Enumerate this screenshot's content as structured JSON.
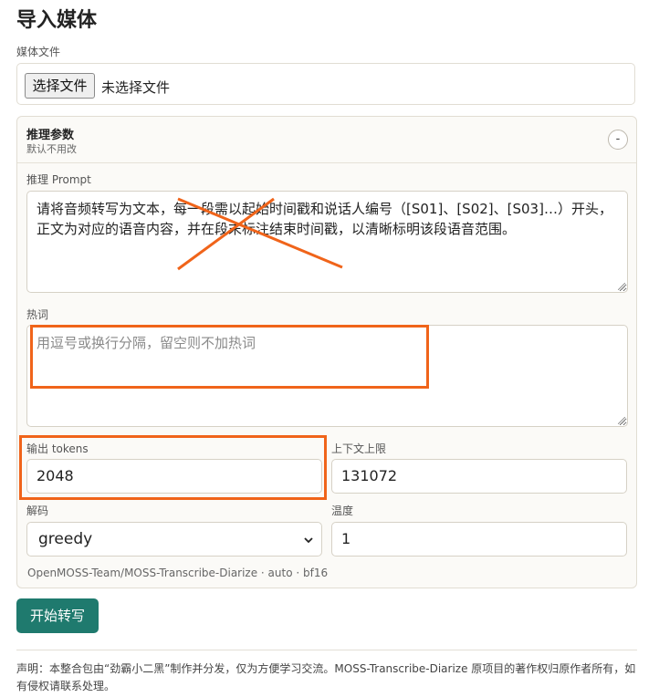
{
  "page": {
    "title": "导入媒体"
  },
  "file_upload": {
    "label": "媒体文件",
    "button_label": "选择文件",
    "status": "未选择文件"
  },
  "inference_panel": {
    "title": "推理参数",
    "subtitle": "默认不用改",
    "collapse_symbol": "-",
    "prompt": {
      "label": "推理 Prompt",
      "value": "请将音频转写为文本，每一段需以起始时间戳和说话人编号（[S01]、[S02]、[S03]…）开头，正文为对应的语音内容，并在段末标注结束时间戳，以清晰标明该段语音范围。"
    },
    "hotwords": {
      "label": "热词",
      "placeholder": "用逗号或换行分隔，留空则不加热词"
    },
    "output_tokens": {
      "label": "输出 tokens",
      "value": "2048"
    },
    "context_limit": {
      "label": "上下文上限",
      "value": "131072"
    },
    "decoding": {
      "label": "解码",
      "value": "greedy"
    },
    "temperature": {
      "label": "温度",
      "value": "1"
    },
    "model_info": "OpenMOSS-Team/MOSS-Transcribe-Diarize · auto · bf16"
  },
  "actions": {
    "start_label": "开始转写"
  },
  "footer": {
    "disclaimer": "声明：本整合包由“劲霸小二黑”制作并分发，仅为方便学习交流。MOSS-Transcribe-Diarize 原项目的著作权归原作者所有，如有侵权请联系处理。"
  },
  "colors": {
    "accent": "#1f7a6e",
    "annotation": "#f0641a"
  },
  "icons": {
    "select_arrow": "chevron-down-icon",
    "annotation_cross": "x-mark-icon"
  }
}
